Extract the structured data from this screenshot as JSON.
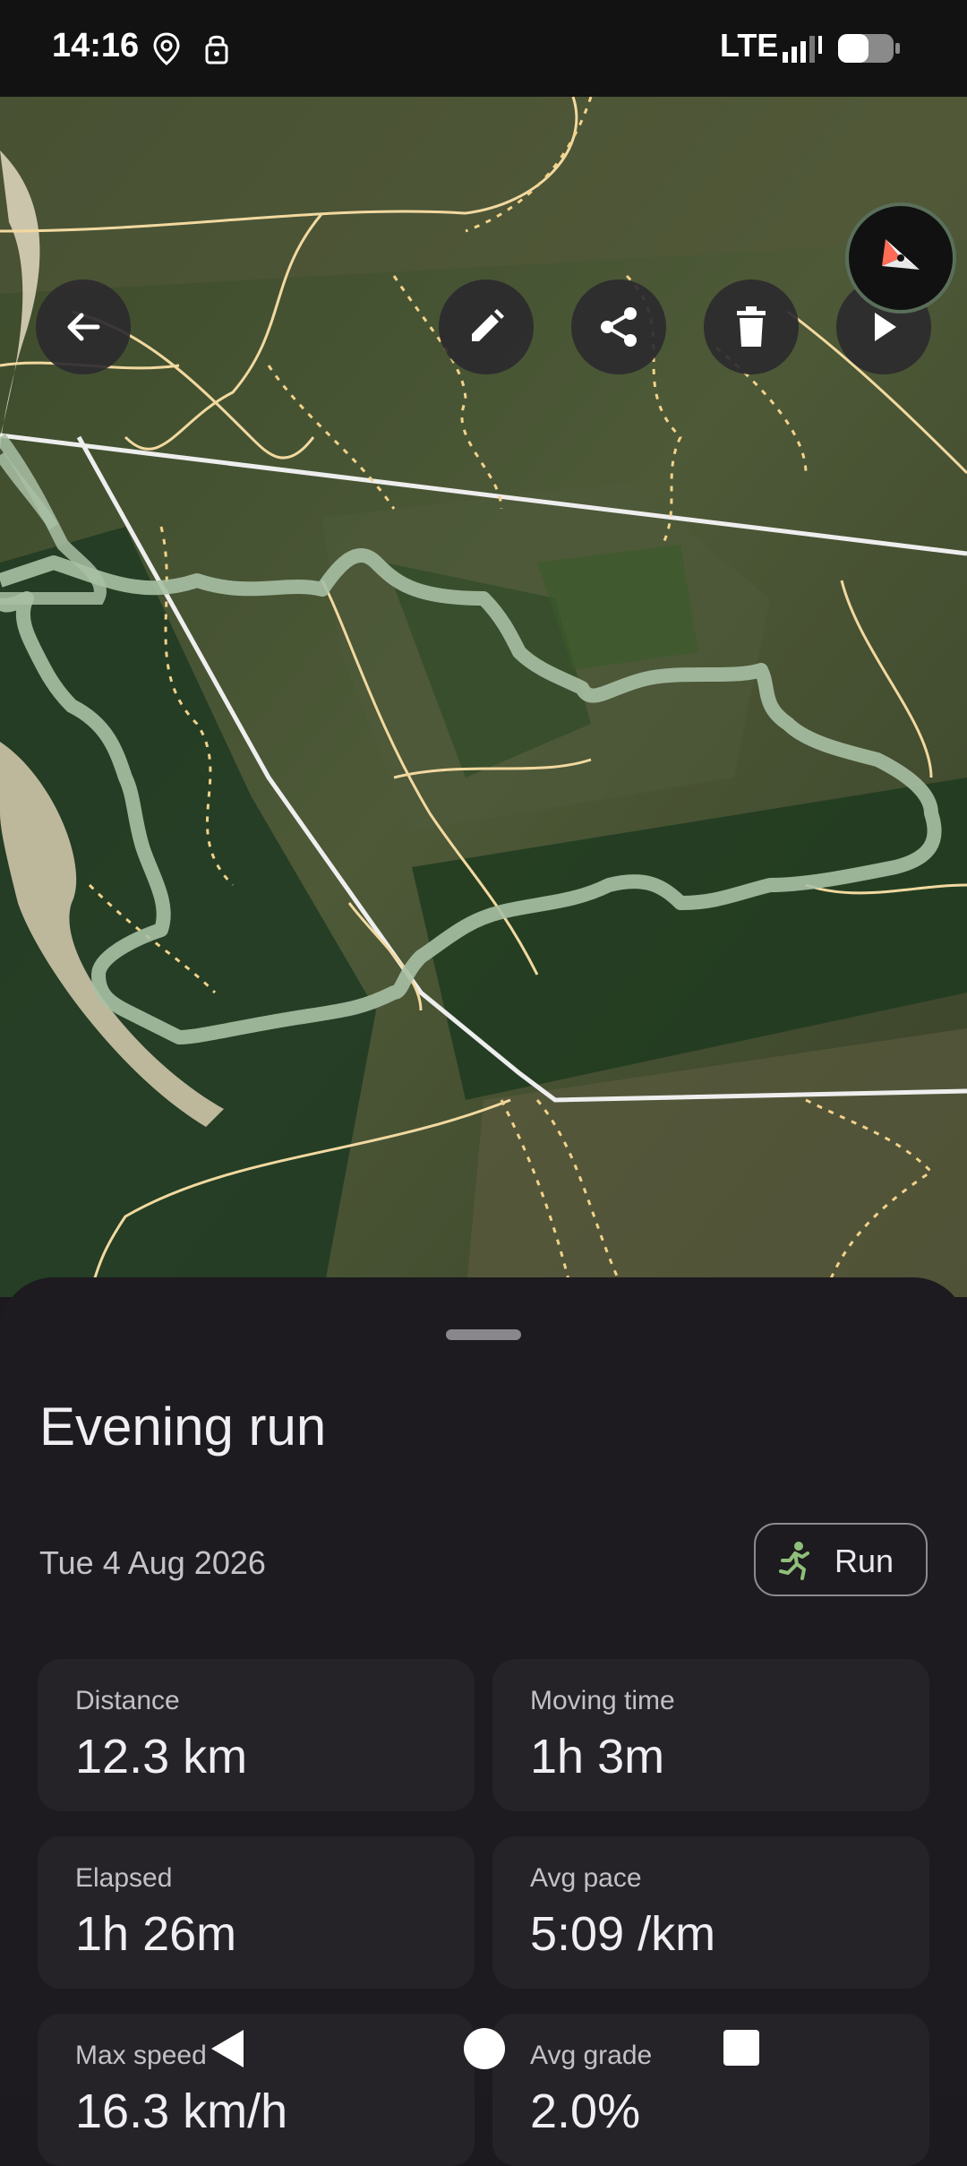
{
  "status_bar": {
    "time": "14:16",
    "network": "LTE"
  },
  "map": {
    "toolbar": [
      "back",
      "edit",
      "share",
      "delete",
      "play"
    ],
    "compass": "compass-icon"
  },
  "activity": {
    "title": "Evening run",
    "date": "Tue 4 Aug 2026",
    "type_chip": {
      "label": "Run",
      "icon": "run-icon"
    }
  },
  "stats": [
    {
      "label": "Distance",
      "value": "12.3 km"
    },
    {
      "label": "Moving time",
      "value": "1h 3m"
    },
    {
      "label": "Elapsed",
      "value": "1h 26m"
    },
    {
      "label": "Avg pace",
      "value": "5:09 /km"
    },
    {
      "label": "Max speed",
      "value": "16.3 km/h"
    },
    {
      "label": "Avg grade",
      "value": "2.0%"
    }
  ],
  "colors": {
    "route": "#9db49a",
    "trail": "#f2d9a0",
    "sheet": "#1d1b1f",
    "card": "#252327"
  }
}
